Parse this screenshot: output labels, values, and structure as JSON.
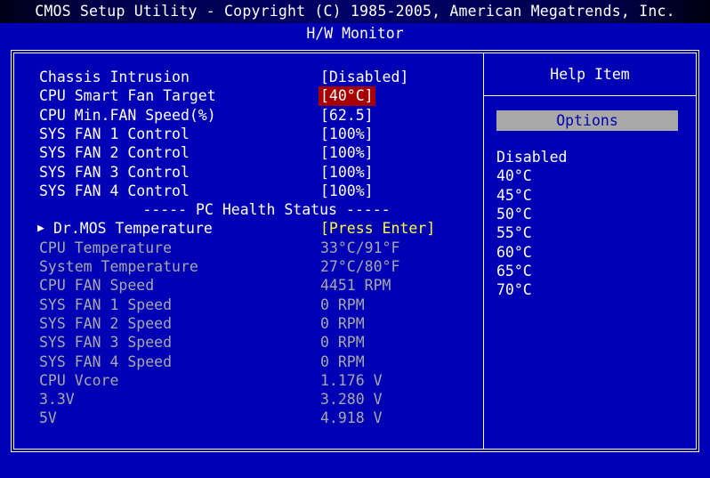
{
  "header": {
    "title": "CMOS Setup Utility - Copyright (C) 1985-2005, American Megatrends, Inc.",
    "subtitle": "H/W Monitor"
  },
  "colors": {
    "background": "#0000b4",
    "titlebar": "#000068",
    "selection": "#a80000",
    "dim_text": "#a8a8a8",
    "accent_text": "#ffff3a",
    "options_bar": "#a8a8a8"
  },
  "settings": {
    "section_header": "----- PC Health Status -----",
    "items": [
      {
        "label": "Chassis Intrusion",
        "value": "[Disabled]",
        "state": "normal"
      },
      {
        "label": "CPU Smart Fan Target",
        "value": "[40°C]",
        "state": "selected"
      },
      {
        "label": "CPU Min.FAN Speed(%)",
        "value": "[62.5]",
        "state": "normal"
      },
      {
        "label": "SYS FAN 1 Control",
        "value": "[100%]",
        "state": "normal"
      },
      {
        "label": "SYS FAN 2 Control",
        "value": "[100%]",
        "state": "normal"
      },
      {
        "label": "SYS FAN 3 Control",
        "value": "[100%]",
        "state": "normal"
      },
      {
        "label": "SYS FAN 4 Control",
        "value": "[100%]",
        "state": "normal"
      }
    ],
    "health_items": [
      {
        "label": "Dr.MOS Temperature",
        "value": "[Press Enter]",
        "state": "submenu",
        "bullet": "▶"
      },
      {
        "label": "CPU Temperature",
        "value": "33°C/91°F",
        "state": "readonly"
      },
      {
        "label": "System Temperature",
        "value": "27°C/80°F",
        "state": "readonly"
      },
      {
        "label": "CPU FAN Speed",
        "value": "4451 RPM",
        "state": "readonly"
      },
      {
        "label": "SYS FAN 1 Speed",
        "value": "0 RPM",
        "state": "readonly"
      },
      {
        "label": "SYS FAN 2 Speed",
        "value": "0 RPM",
        "state": "readonly"
      },
      {
        "label": "SYS FAN 3 Speed",
        "value": "0 RPM",
        "state": "readonly"
      },
      {
        "label": "SYS FAN 4 Speed",
        "value": "0 RPM",
        "state": "readonly"
      },
      {
        "label": "CPU Vcore",
        "value": "1.176 V",
        "state": "readonly"
      },
      {
        "label": "3.3V",
        "value": "3.280 V",
        "state": "readonly"
      },
      {
        "label": "5V",
        "value": "4.918 V",
        "state": "readonly"
      }
    ]
  },
  "help": {
    "title": "Help Item",
    "options_label": "Options",
    "options": [
      "Disabled",
      "40°C",
      "45°C",
      "50°C",
      "55°C",
      "60°C",
      "65°C",
      "70°C"
    ]
  }
}
